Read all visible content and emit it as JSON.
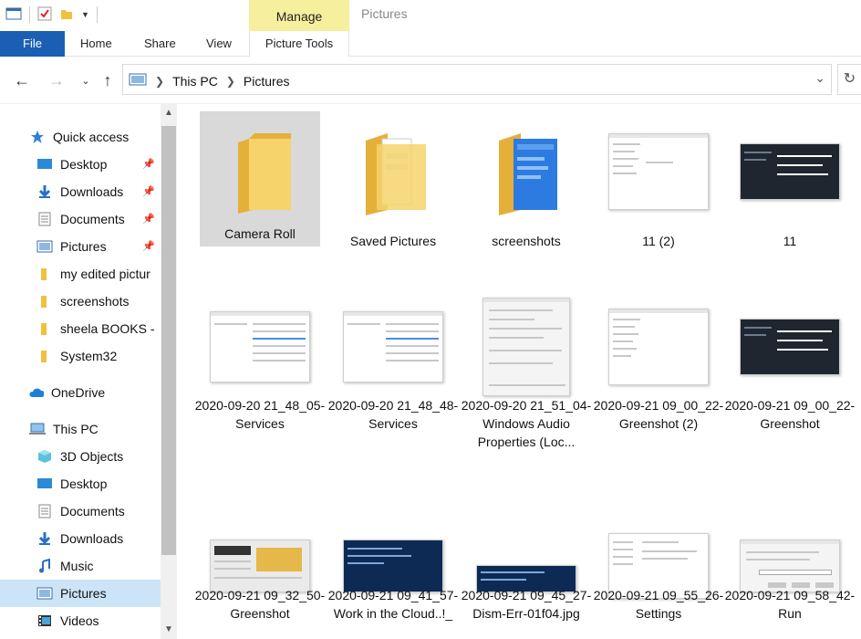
{
  "window": {
    "title": "Pictures"
  },
  "ribbon": {
    "context_tab": "Manage",
    "file_tab": "File",
    "tabs": [
      "Home",
      "Share",
      "View"
    ],
    "context_tools": "Picture Tools"
  },
  "address": {
    "crumbs": [
      "This PC",
      "Pictures"
    ]
  },
  "sidebar": {
    "quick_access": "Quick access",
    "items": [
      {
        "label": "Desktop",
        "icon": "desktop-icon",
        "pinned": true
      },
      {
        "label": "Downloads",
        "icon": "downloads-icon",
        "pinned": true
      },
      {
        "label": "Documents",
        "icon": "documents-icon",
        "pinned": true
      },
      {
        "label": "Pictures",
        "icon": "pictures-icon",
        "pinned": true
      },
      {
        "label": "my edited pictur",
        "icon": "folder-icon",
        "pinned": false
      },
      {
        "label": "screenshots",
        "icon": "folder-icon",
        "pinned": false
      },
      {
        "label": "sheela BOOKS -",
        "icon": "folder-icon",
        "pinned": false
      },
      {
        "label": "System32",
        "icon": "folder-icon",
        "pinned": false
      }
    ],
    "onedrive": "OneDrive",
    "this_pc": "This PC",
    "pc_items": [
      {
        "label": "3D Objects",
        "icon": "3d-objects-icon"
      },
      {
        "label": "Desktop",
        "icon": "desktop-icon"
      },
      {
        "label": "Documents",
        "icon": "documents-icon"
      },
      {
        "label": "Downloads",
        "icon": "downloads-icon"
      },
      {
        "label": "Music",
        "icon": "music-icon"
      },
      {
        "label": "Pictures",
        "icon": "pictures-icon"
      },
      {
        "label": "Videos",
        "icon": "videos-icon"
      }
    ]
  },
  "files": [
    {
      "name": "Camera Roll",
      "kind": "folder"
    },
    {
      "name": "Saved Pictures",
      "kind": "folder-docs"
    },
    {
      "name": "screenshots",
      "kind": "folder-blue"
    },
    {
      "name": "11 (2)",
      "kind": "shot-light"
    },
    {
      "name": "11",
      "kind": "shot-dark"
    },
    {
      "name": "2020-09-20 21_48_05-Services",
      "kind": "shot-light"
    },
    {
      "name": "2020-09-20 21_48_48-Services",
      "kind": "shot-light"
    },
    {
      "name": "2020-09-20 21_51_04-Windows Audio Properties (Loc...",
      "kind": "shot-dialog"
    },
    {
      "name": "2020-09-21 09_00_22-Greenshot (2)",
      "kind": "shot-light"
    },
    {
      "name": "2020-09-21 09_00_22-Greenshot",
      "kind": "shot-dark"
    },
    {
      "name": "2020-09-21 09_32_50-Greenshot",
      "kind": "shot-mixed"
    },
    {
      "name": "2020-09-21 09_41_57-Work in the Cloud..!_",
      "kind": "shot-blue"
    },
    {
      "name": "2020-09-21 09_45_27-Dism-Err-01f04.jpg",
      "kind": "shot-blue"
    },
    {
      "name": "2020-09-21 09_55_26-Settings",
      "kind": "shot-light"
    },
    {
      "name": "2020-09-21 09_58_42-Run",
      "kind": "shot-dialog"
    }
  ]
}
